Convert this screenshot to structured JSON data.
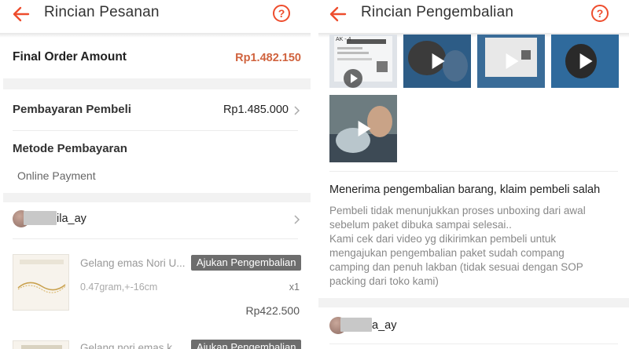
{
  "left": {
    "header": {
      "title": "Rincian Pesanan",
      "help_icon": "question-circle-icon",
      "back_icon": "arrow-left-icon"
    },
    "final_order": {
      "label": "Final Order Amount",
      "value": "Rp1.482.150"
    },
    "payment": {
      "label": "Pembayaran Pembeli",
      "value": "Rp1.485.000"
    },
    "method": {
      "label": "Metode Pembayaran",
      "value": "Online Payment"
    },
    "buyer": {
      "name_suffix": "ila_ay"
    },
    "products": [
      {
        "name": "Gelang emas Nori U...",
        "action": "Ajukan Pengembalian",
        "spec": "0.47gram,+-16cm",
        "qty": "x1",
        "price": "Rp422.500"
      },
      {
        "name": "Gelang nori emas k",
        "action": "Ajukan Pengembalian"
      }
    ]
  },
  "right": {
    "header": {
      "title": "Rincian Pengembalian",
      "help_icon": "question-circle-icon",
      "back_icon": "arrow-left-icon"
    },
    "media_tags": {
      "label_text": "AK - 4"
    },
    "reason_title": "Menerima pengembalian barang, klaim pembeli salah",
    "reason_lines": [
      "Pembeli tidak menunjukkan proses unboxing dari awal",
      "sebelum paket dibuka sampai selesai..",
      "Kami cek dari video yg dikirimkan pembeli untuk",
      "mengajukan pengembalian paket sudah compang",
      "camping dan penuh lakban (tidak sesuai dengan SOP",
      "packing dari toko kami)"
    ],
    "buyer": {
      "name_suffix": "a_ay"
    }
  },
  "colors": {
    "accent": "#ee4d2d",
    "price": "#d0633e",
    "button_gray": "#6d6d6d"
  }
}
